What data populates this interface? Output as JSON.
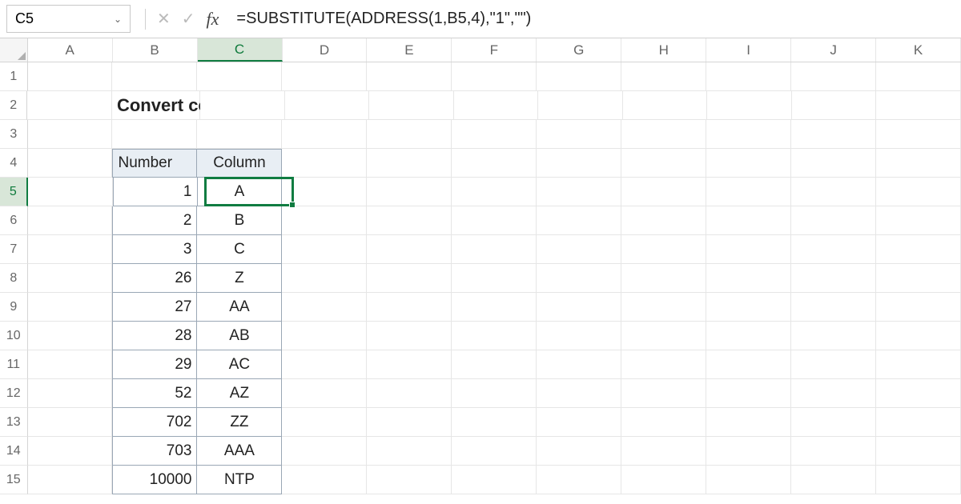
{
  "app": "Excel",
  "formula_bar": {
    "name_box": "C5",
    "formula": "=SUBSTITUTE(ADDRESS(1,B5,4),\"1\",\"\")"
  },
  "active_cell": {
    "col": "C",
    "row": 5
  },
  "columns": [
    "A",
    "B",
    "C",
    "D",
    "E",
    "F",
    "G",
    "H",
    "I",
    "J",
    "K"
  ],
  "row_numbers": [
    1,
    2,
    3,
    4,
    5,
    6,
    7,
    8,
    9,
    10,
    11,
    12,
    13,
    14,
    15
  ],
  "sheet": {
    "title": "Convert column number to letter",
    "table": {
      "headers": {
        "number": "Number",
        "column": "Column"
      },
      "rows": [
        {
          "number": "1",
          "column": "A"
        },
        {
          "number": "2",
          "column": "B"
        },
        {
          "number": "3",
          "column": "C"
        },
        {
          "number": "26",
          "column": "Z"
        },
        {
          "number": "27",
          "column": "AA"
        },
        {
          "number": "28",
          "column": "AB"
        },
        {
          "number": "29",
          "column": "AC"
        },
        {
          "number": "52",
          "column": "AZ"
        },
        {
          "number": "702",
          "column": "ZZ"
        },
        {
          "number": "703",
          "column": "AAA"
        },
        {
          "number": "10000",
          "column": "NTP"
        }
      ]
    }
  },
  "colors": {
    "accent_green": "#107c41",
    "header_fill": "#e8eef4",
    "table_border": "#9aa7b5"
  }
}
